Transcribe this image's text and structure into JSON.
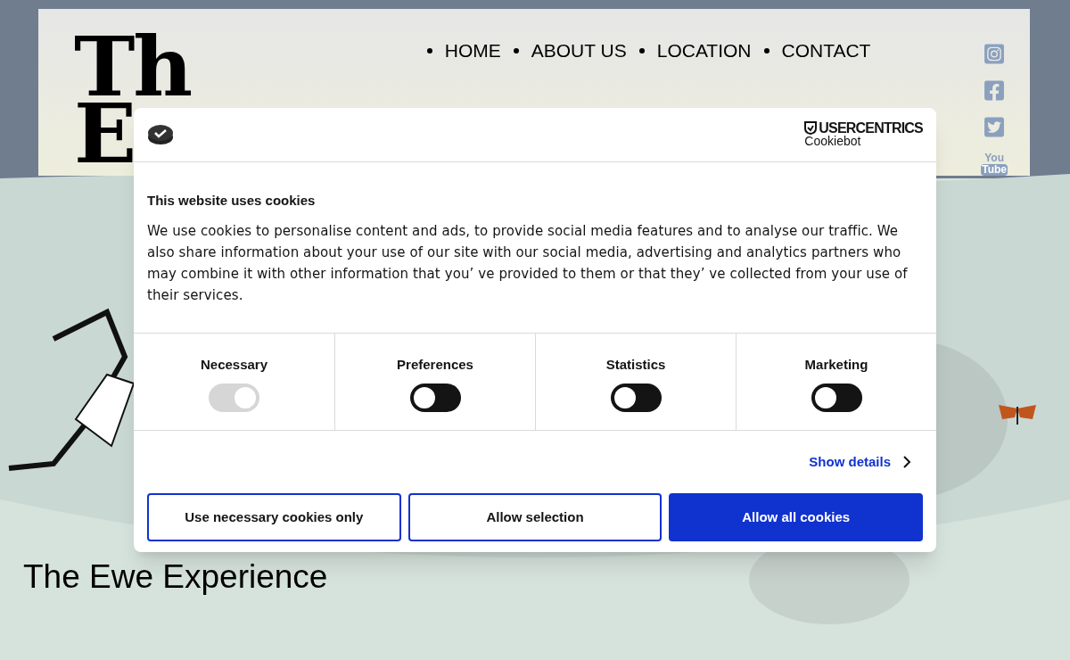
{
  "site": {
    "logo_lines": [
      "Th",
      "E"
    ],
    "nav": [
      {
        "label": "HOME"
      },
      {
        "label": "ABOUT US"
      },
      {
        "label": "LOCATION"
      },
      {
        "label": "CONTACT"
      }
    ],
    "social": [
      {
        "kind": "instagram"
      },
      {
        "kind": "facebook"
      },
      {
        "kind": "twitter"
      },
      {
        "kind": "youtube",
        "lines": [
          "You",
          "Tube"
        ]
      }
    ],
    "page_title": "The Ewe Experience"
  },
  "cookie_dialog": {
    "brand": "USERCENTRICS",
    "product": "Cookiebot",
    "title": "This website uses cookies",
    "text": "We use cookies to personalise content and ads, to provide social media features and to analyse our traffic. We also share information about your use of our site with our social media, advertising and analytics partners who may combine it with other information that you’ ve provided to them or that they’ ve collected from your use of their services.",
    "categories": [
      {
        "label": "Necessary",
        "checked": true,
        "disabled": true
      },
      {
        "label": "Preferences",
        "checked": false,
        "disabled": false
      },
      {
        "label": "Statistics",
        "checked": false,
        "disabled": false
      },
      {
        "label": "Marketing",
        "checked": false,
        "disabled": false
      }
    ],
    "details_link": "Show details",
    "buttons": [
      {
        "label": "Use necessary cookies only",
        "kind": "outline"
      },
      {
        "label": "Allow selection",
        "kind": "outline"
      },
      {
        "label": "Allow all cookies",
        "kind": "primary"
      }
    ]
  }
}
